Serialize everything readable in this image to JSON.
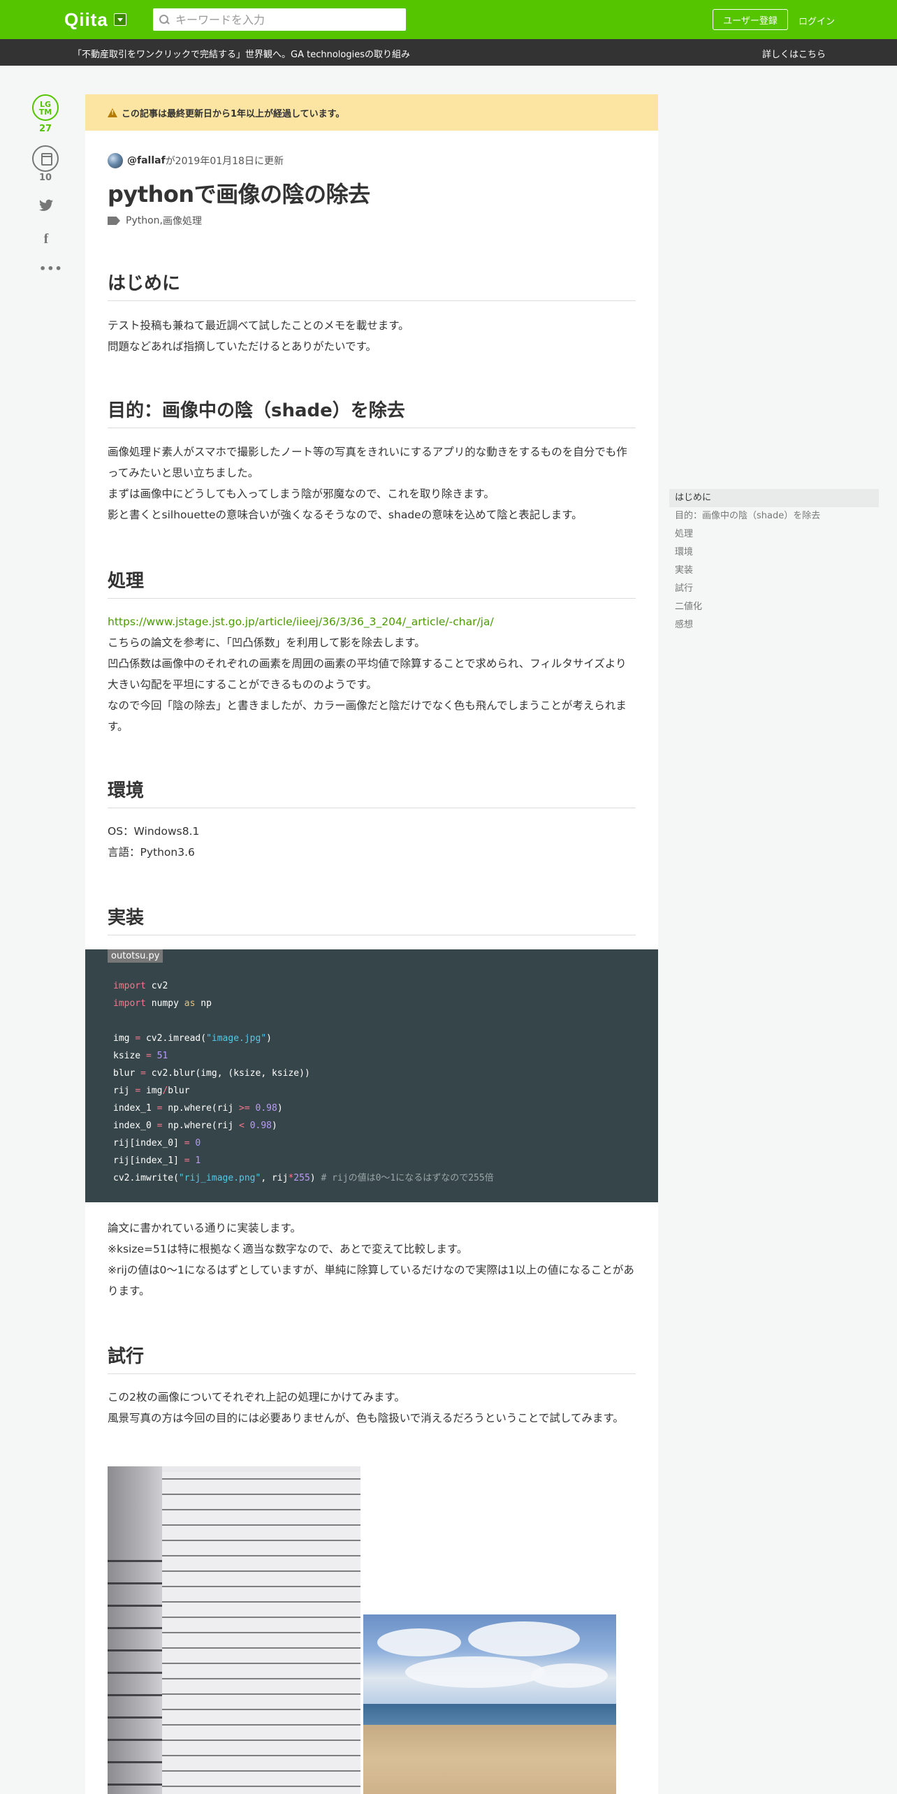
{
  "header": {
    "logo": "Qiita",
    "search_placeholder": "キーワードを入力",
    "signup_label": "ユーザー登録",
    "login_label": "ログイン"
  },
  "banner": {
    "text": "「不動産取引をワンクリックで完結する」世界観へ。GA technologiesの取り組み",
    "link": "詳しくはこちら"
  },
  "actions": {
    "lgtm_label_top": "LG",
    "lgtm_label_bottom": "TM",
    "lgtm_count": "27",
    "stock_count": "10",
    "more_label": "•••"
  },
  "article": {
    "notice": "この記事は最終更新日から1年以上が経過しています。",
    "author_name": "@fallaf",
    "updated_text": " が2019年01月18日に更新",
    "title": "pythonで画像の陰の除去",
    "tags": [
      "Python",
      "画像処理"
    ],
    "tag_separator": ", ",
    "sections": {
      "intro": {
        "heading": "はじめに",
        "lines": [
          "テスト投稿も兼ねて最近調べて試したことのメモを載せます。",
          "問題などあれば指摘していただけるとありがたいです。"
        ]
      },
      "purpose": {
        "heading": "目的：画像中の陰（shade）を除去",
        "lines": [
          "画像処理ド素人がスマホで撮影したノート等の写真をきれいにするアプリ的な動きをするものを自分でも作ってみたいと思い立ちました。",
          "まずは画像中にどうしても入ってしまう陰が邪魔なので、これを取り除きます。",
          "影と書くとsilhouetteの意味合いが強くなるそうなので、shadeの意味を込めて陰と表記します。"
        ]
      },
      "process": {
        "heading": "処理",
        "link": "https://www.jstage.jst.go.jp/article/iieej/36/3/36_3_204/_article/-char/ja/",
        "lines": [
          "こちらの論文を参考に、「凹凸係数」を利用して影を除去します。",
          "凹凸係数は画像中のそれぞれの画素を周囲の画素の平均値で除算することで求められ、フィルタサイズより大きい勾配を平坦にすることができるもののようです。",
          "なので今回「陰の除去」と書きましたが、カラー画像だと陰だけでなく色も飛んでしまうことが考えられます。"
        ]
      },
      "env": {
        "heading": "環境",
        "lines": [
          "OS：Windows8.1",
          "言語：Python3.6"
        ]
      },
      "impl": {
        "heading": "実装",
        "filename": "outotsu.py",
        "after_lines": [
          "論文に書かれている通りに実装します。",
          "※ksize=51は特に根拠なく適当な数字なので、あとで変えて比較します。",
          "※rijの値は0～1になるはずとしていますが、単純に除算しているだけなので実際は1以上の値になることがあります。"
        ]
      },
      "trial": {
        "heading": "試行",
        "lines": [
          "この2枚の画像についてそれぞれ上記の処理にかけてみます。",
          "風景写真の方は今回の目的には必要ありませんが、色も陰扱いで消えるだろうということで試してみます。"
        ]
      }
    }
  },
  "code": {
    "comment": "# rijの値は0～1になるはずなので255倍"
  },
  "toc": {
    "items": [
      "はじめに",
      "目的：画像中の陰（shade）を除去",
      "処理",
      "環境",
      "実装",
      "試行",
      "二値化",
      "感想"
    ]
  }
}
